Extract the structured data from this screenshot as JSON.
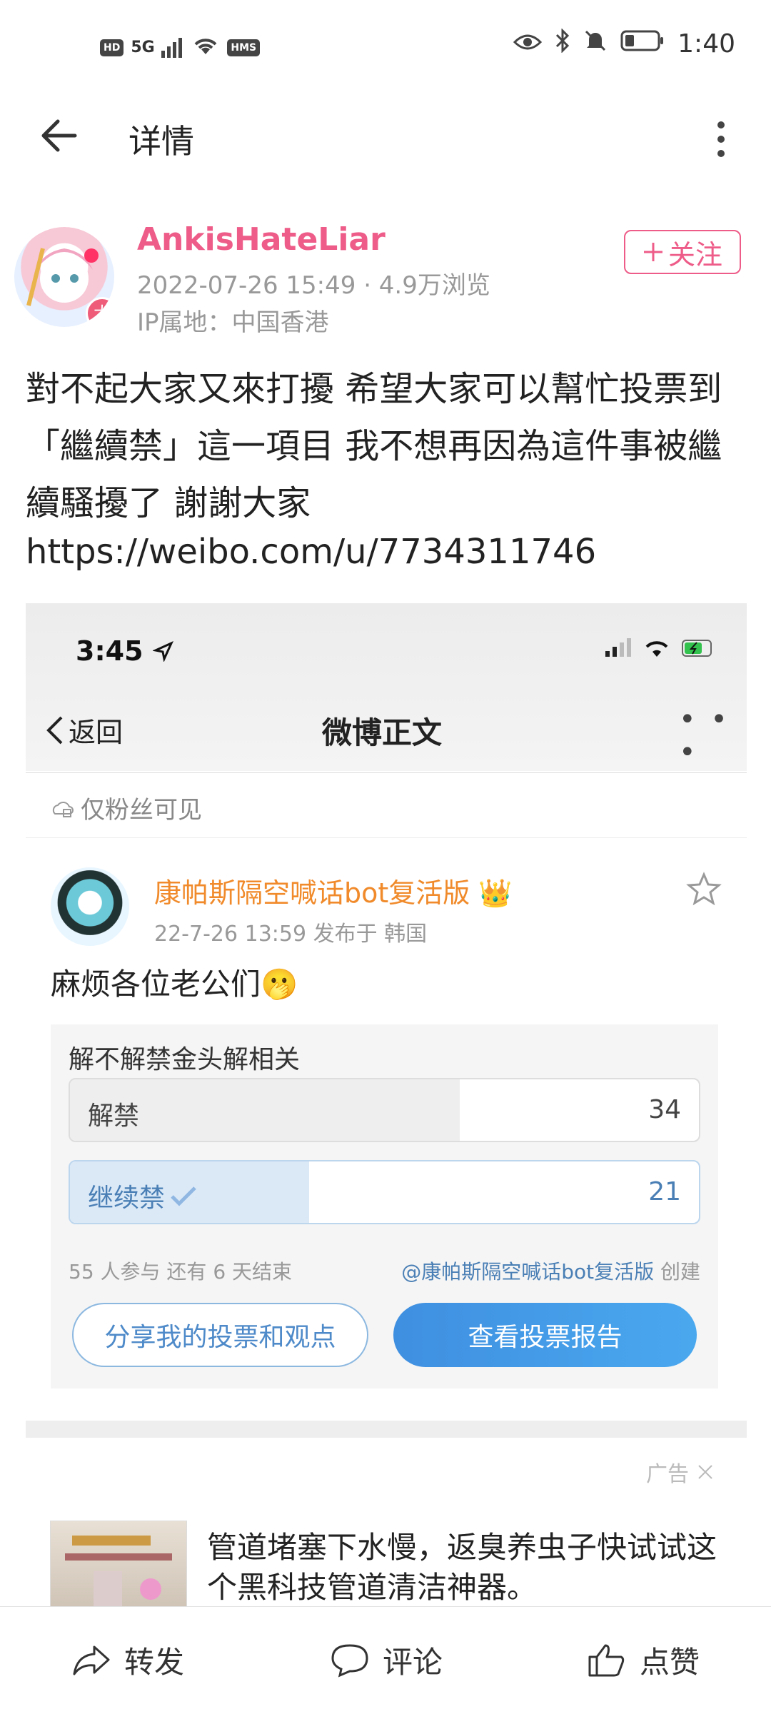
{
  "status_bar": {
    "left_badges": [
      "HD",
      "5G",
      "HMS"
    ],
    "time": "1:40"
  },
  "header": {
    "title": "详情"
  },
  "author": {
    "name": "AnkisHateLiar",
    "avatar_badge": "大",
    "date_views": "2022-07-26 15:49 · 4.9万浏览",
    "ip": "IP属地：中国香港",
    "follow_label": "关注"
  },
  "post": {
    "text": "對不起大家又來打擾 希望大家可以幫忙投票到「繼續禁」這一項目 我不想再因為這件事被繼續騷擾了 謝謝大家",
    "link": "https://weibo.com/u/7734311746"
  },
  "embedded": {
    "time": "3:45",
    "back_label": "返回",
    "nav_title": "微博正文",
    "visibility": "仅粉丝可见",
    "bot_name": "康帕斯隔空喊话bot复活版",
    "bot_meta": "22-7-26 13:59  发布于 韩国",
    "bot_text": "麻烦各位老公们🫢",
    "poll": {
      "title": "解不解禁金头解相关",
      "options": [
        {
          "label": "解禁",
          "count": "34",
          "fraction": 0.62
        },
        {
          "label": "继续禁",
          "count": "21",
          "fraction": 0.38,
          "selected": true
        }
      ],
      "footer_left": "55 人参与  还有 6 天结束",
      "footer_right_at": "@康帕斯隔空喊话bot复活版",
      "footer_right_suffix": "创建",
      "share_button": "分享我的投票和观点",
      "report_button": "查看投票报告"
    }
  },
  "ad": {
    "label": "广告",
    "text": "管道堵塞下水慢，返臭养虫子快试试这个黑科技管道清洁神器。"
  },
  "bottom_bar": {
    "repost": "转发",
    "comment": "评论",
    "like": "点赞"
  },
  "colors": {
    "accent_pink": "#ee5c89",
    "poll_blue": "#3f8fe0",
    "bot_orange": "#f08a2a"
  }
}
